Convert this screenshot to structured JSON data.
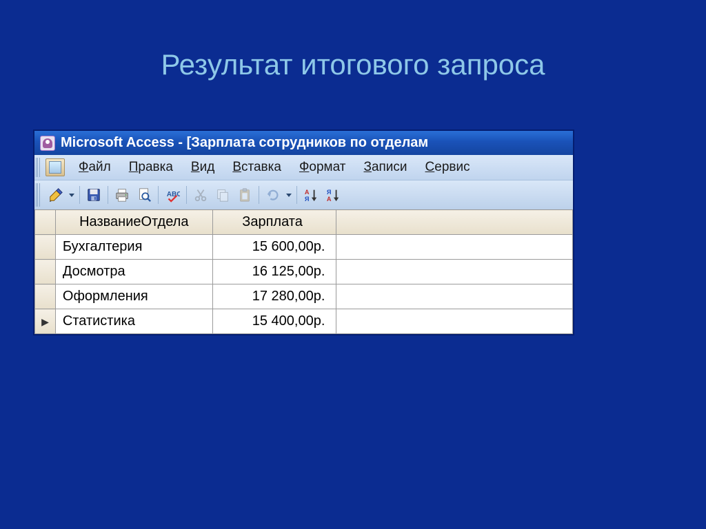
{
  "slide": {
    "title": "Результат итогового запроса"
  },
  "window": {
    "title": "Microsoft Access - [Зарплата сотрудников по отделам"
  },
  "menu": {
    "file": "Файл",
    "edit": "Правка",
    "view": "Вид",
    "insert": "Вставка",
    "format": "Формат",
    "records": "Записи",
    "service": "Сервис"
  },
  "columns": {
    "department": "НазваниеОтдела",
    "salary": "Зарплата"
  },
  "rows": [
    {
      "dept": "Бухгалтерия",
      "salary": "15 600,00р.",
      "current": false
    },
    {
      "dept": "Досмотра",
      "salary": "16 125,00р.",
      "current": false
    },
    {
      "dept": "Оформления",
      "salary": "17 280,00р.",
      "current": false
    },
    {
      "dept": "Статистика",
      "salary": "15 400,00р.",
      "current": true
    }
  ],
  "icons": {
    "app": "access-key-icon",
    "design": "design-view-icon",
    "save": "save-icon",
    "print": "print-icon",
    "preview": "preview-icon",
    "spell": "spellcheck-icon",
    "cut": "cut-icon",
    "copy": "copy-icon",
    "paste": "paste-icon",
    "undo": "undo-icon",
    "sortasc": "sort-asc-icon",
    "sortdesc": "sort-desc-icon"
  }
}
